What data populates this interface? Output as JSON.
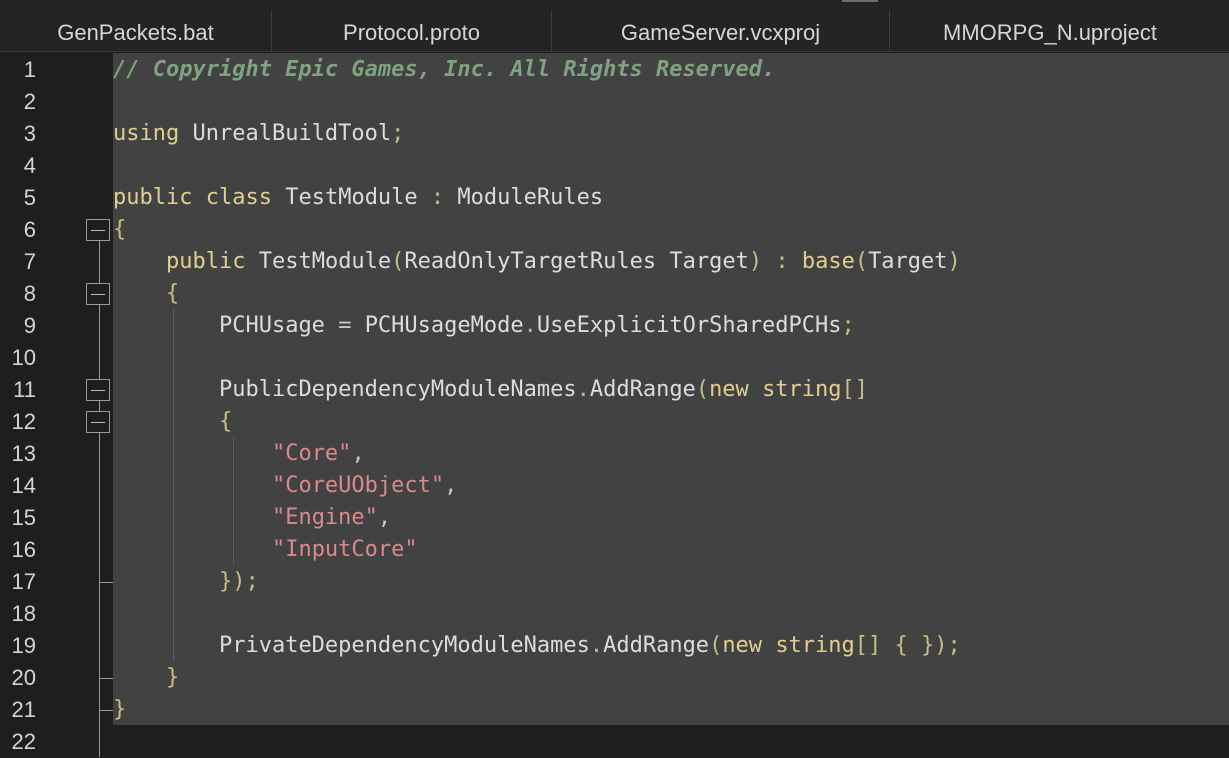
{
  "tabs": [
    {
      "label": "GenPackets.bat"
    },
    {
      "label": "Protocol.proto"
    },
    {
      "label": "GameServer.vcxproj"
    },
    {
      "label": "MMORPG_N.uproject"
    }
  ],
  "line_numbers": [
    "1",
    "2",
    "3",
    "4",
    "5",
    "6",
    "7",
    "8",
    "9",
    "10",
    "11",
    "12",
    "13",
    "14",
    "15",
    "16",
    "17",
    "18",
    "19",
    "20",
    "21",
    "22"
  ],
  "code": {
    "l1": "// Copyright Epic Games, Inc. All Rights Reserved.",
    "l3_using": "using",
    "l3_name": "UnrealBuildTool",
    "l3_semi": ";",
    "l5_public": "public",
    "l5_class": "class",
    "l5_name": "TestModule",
    "l5_colon": ":",
    "l5_base": "ModuleRules",
    "l6_brace": "{",
    "l7_public": "public",
    "l7_ctor": "TestModule",
    "l7_open": "(",
    "l7_type": "ReadOnlyTargetRules",
    "l7_param": "Target",
    "l7_close": ")",
    "l7_colon": ":",
    "l7_base": "base",
    "l7_open2": "(",
    "l7_arg": "Target",
    "l7_close2": ")",
    "l8_brace": "{",
    "l9_lhs": "PCHUsage",
    "l9_eq": "=",
    "l9_enum": "PCHUsageMode",
    "l9_dot": ".",
    "l9_val": "UseExplicitOrSharedPCHs",
    "l9_semi": ";",
    "l11_obj": "PublicDependencyModuleNames",
    "l11_dot": ".",
    "l11_method": "AddRange",
    "l11_open": "(",
    "l11_new": "new",
    "l11_type": "string",
    "l11_arr": "[]",
    "l12_brace": "{",
    "l13_str": "\"Core\"",
    "l13_comma": ",",
    "l14_str": "\"CoreUObject\"",
    "l14_comma": ",",
    "l15_str": "\"Engine\"",
    "l15_comma": ",",
    "l16_str": "\"InputCore\"",
    "l17_close": "})",
    "l17_semi": ";",
    "l19_obj": "PrivateDependencyModuleNames",
    "l19_dot": ".",
    "l19_method": "AddRange",
    "l19_open": "(",
    "l19_new": "new",
    "l19_type": "string",
    "l19_arr": "[]",
    "l19_braces": "{ })",
    "l19_semi": ";",
    "l20_brace": "}",
    "l21_brace": "}"
  },
  "colors": {
    "comment": "#7fa27f",
    "keyword": "#e2cf8e",
    "string": "#d98a8a",
    "editor_bg": "#424242"
  }
}
